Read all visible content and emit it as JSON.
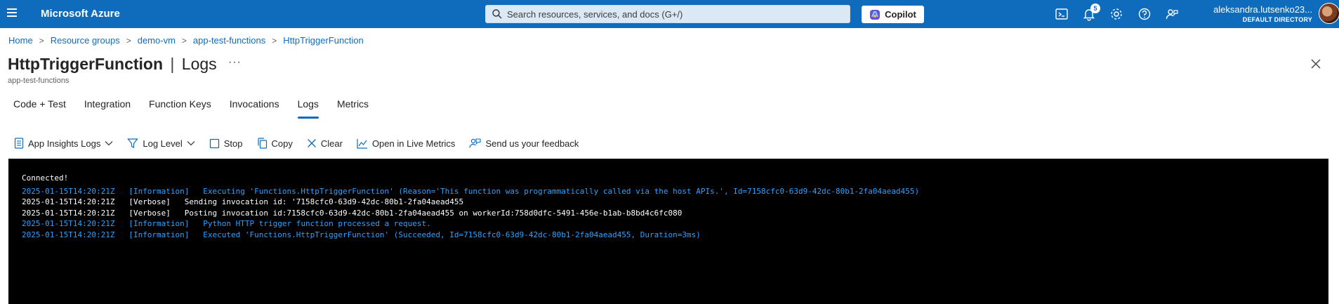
{
  "topbar": {
    "brand": "Microsoft Azure",
    "search_placeholder": "Search resources, services, and docs (G+/)",
    "copilot_label": "Copilot",
    "notifications_count": "5",
    "user_name": "aleksandra.lutsenko23...",
    "user_directory": "DEFAULT DIRECTORY"
  },
  "breadcrumb": [
    "Home",
    "Resource groups",
    "demo-vm",
    "app-test-functions",
    "HttpTriggerFunction"
  ],
  "header": {
    "title_main": "HttpTriggerFunction",
    "title_sep": "|",
    "title_section": "Logs",
    "subtitle": "app-test-functions",
    "more": "···"
  },
  "tabs": [
    "Code + Test",
    "Integration",
    "Function Keys",
    "Invocations",
    "Logs",
    "Metrics"
  ],
  "active_tab": "Logs",
  "toolbar": {
    "app_insights": "App Insights Logs",
    "log_level": "Log Level",
    "stop": "Stop",
    "copy": "Copy",
    "clear": "Clear",
    "live_metrics": "Open in Live Metrics",
    "feedback": "Send us your feedback"
  },
  "console": {
    "connected": "Connected!",
    "lines": [
      {
        "color": "blue",
        "text": "2025-01-15T14:20:21Z   [Information]   Executing 'Functions.HttpTriggerFunction' (Reason='This function was programmatically called via the host APIs.', Id=7158cfc0-63d9-42dc-80b1-2fa04aead455)"
      },
      {
        "color": "white",
        "text": "2025-01-15T14:20:21Z   [Verbose]   Sending invocation id: '7158cfc0-63d9-42dc-80b1-2fa04aead455"
      },
      {
        "color": "white",
        "text": "2025-01-15T14:20:21Z   [Verbose]   Posting invocation id:7158cfc0-63d9-42dc-80b1-2fa04aead455 on workerId:758d0dfc-5491-456e-b1ab-b8bd4c6fc080"
      },
      {
        "color": "blue",
        "text": "2025-01-15T14:20:21Z   [Information]   Python HTTP trigger function processed a request."
      },
      {
        "color": "blue",
        "text": "2025-01-15T14:20:21Z   [Information]   Executed 'Functions.HttpTriggerFunction' (Succeeded, Id=7158cfc0-63d9-42dc-80b1-2fa04aead455, Duration=3ms)"
      }
    ]
  },
  "colors": {
    "accent": "#0f6cbd",
    "console_bg": "#000000",
    "log_blue": "#2ea1ff",
    "log_white": "#ffffff"
  }
}
